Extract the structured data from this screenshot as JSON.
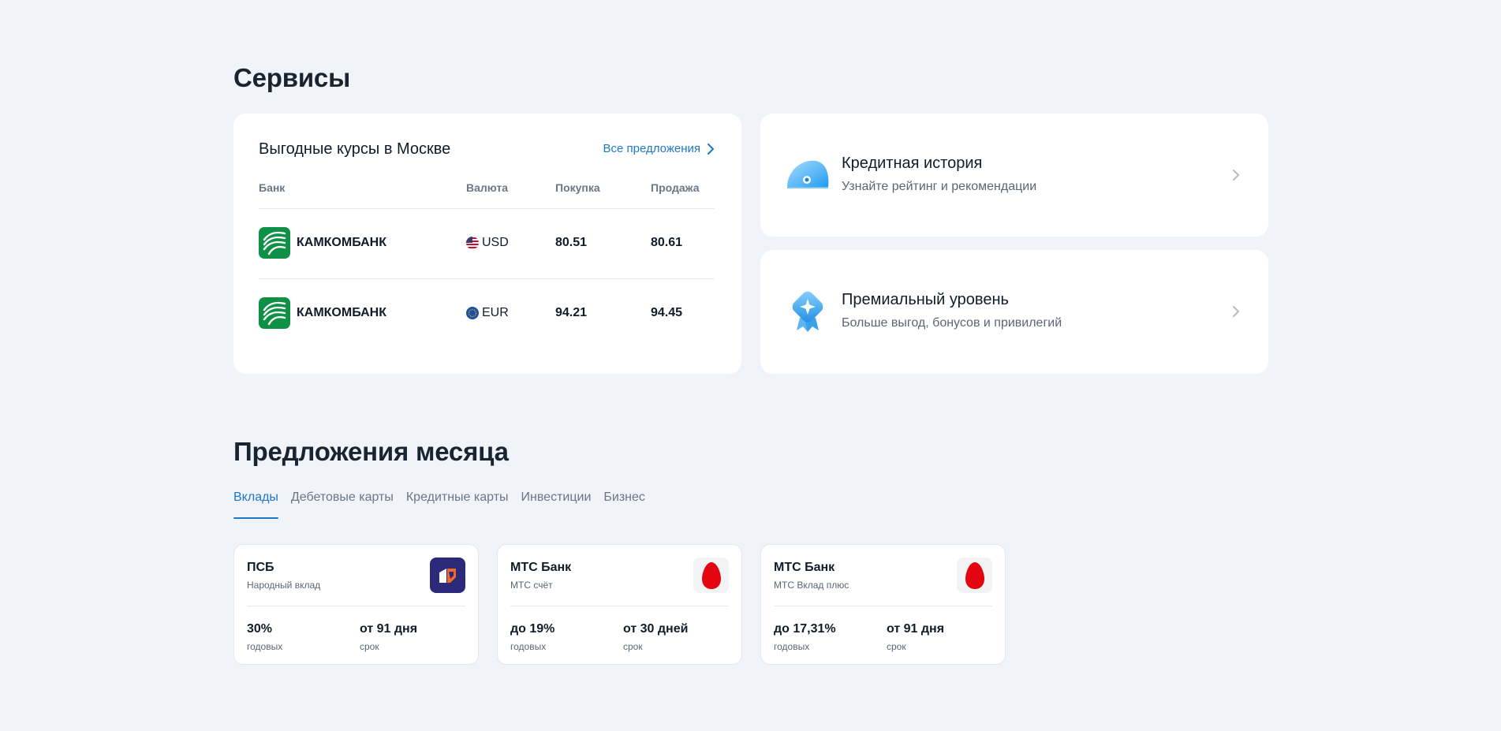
{
  "services": {
    "title": "Сервисы",
    "rates": {
      "title": "Выгодные курсы в Москве",
      "all_offers": "Все предложения",
      "columns": {
        "bank": "Банк",
        "currency": "Валюта",
        "buy": "Покупка",
        "sell": "Продажа"
      },
      "rows": [
        {
          "bank": "КАМКОМБАНК",
          "currency": "USD",
          "buy": "80.51",
          "sell": "80.61"
        },
        {
          "bank": "КАМКОМБАНК",
          "currency": "EUR",
          "buy": "94.21",
          "sell": "94.45"
        }
      ]
    },
    "credit_history": {
      "title": "Кредитная история",
      "subtitle": "Узнайте рейтинг и рекомендации"
    },
    "premium": {
      "title": "Премиальный уровень",
      "subtitle": "Больше выгод, бонусов и привилегий"
    }
  },
  "offers_month": {
    "title": "Предложения месяца",
    "tabs": [
      {
        "label": "Вклады",
        "active": true
      },
      {
        "label": "Дебетовые карты",
        "active": false
      },
      {
        "label": "Кредитные карты",
        "active": false
      },
      {
        "label": "Инвестиции",
        "active": false
      },
      {
        "label": "Бизнес",
        "active": false
      }
    ],
    "cards": [
      {
        "bank": "ПСБ",
        "product": "Народный вклад",
        "rate": "30%",
        "rate_label": "годовых",
        "term": "от 91 дня",
        "term_label": "срок",
        "logo": "psb-logo"
      },
      {
        "bank": "МТС Банк",
        "product": "МТС счёт",
        "rate": "до 19%",
        "rate_label": "годовых",
        "term": "от 30 дней",
        "term_label": "срок",
        "logo": "mts-logo"
      },
      {
        "bank": "МТС Банк",
        "product": "МТС Вклад плюс",
        "rate": "до 17,31%",
        "rate_label": "годовых",
        "term": "от 91 дня",
        "term_label": "срок",
        "logo": "mts-logo"
      }
    ]
  },
  "colors": {
    "accent": "#1e78c8",
    "background": "#f0f3f8",
    "kamkom_green": "#0e9146",
    "psb_navy": "#2b2a7a",
    "mts_red": "#e30611"
  }
}
